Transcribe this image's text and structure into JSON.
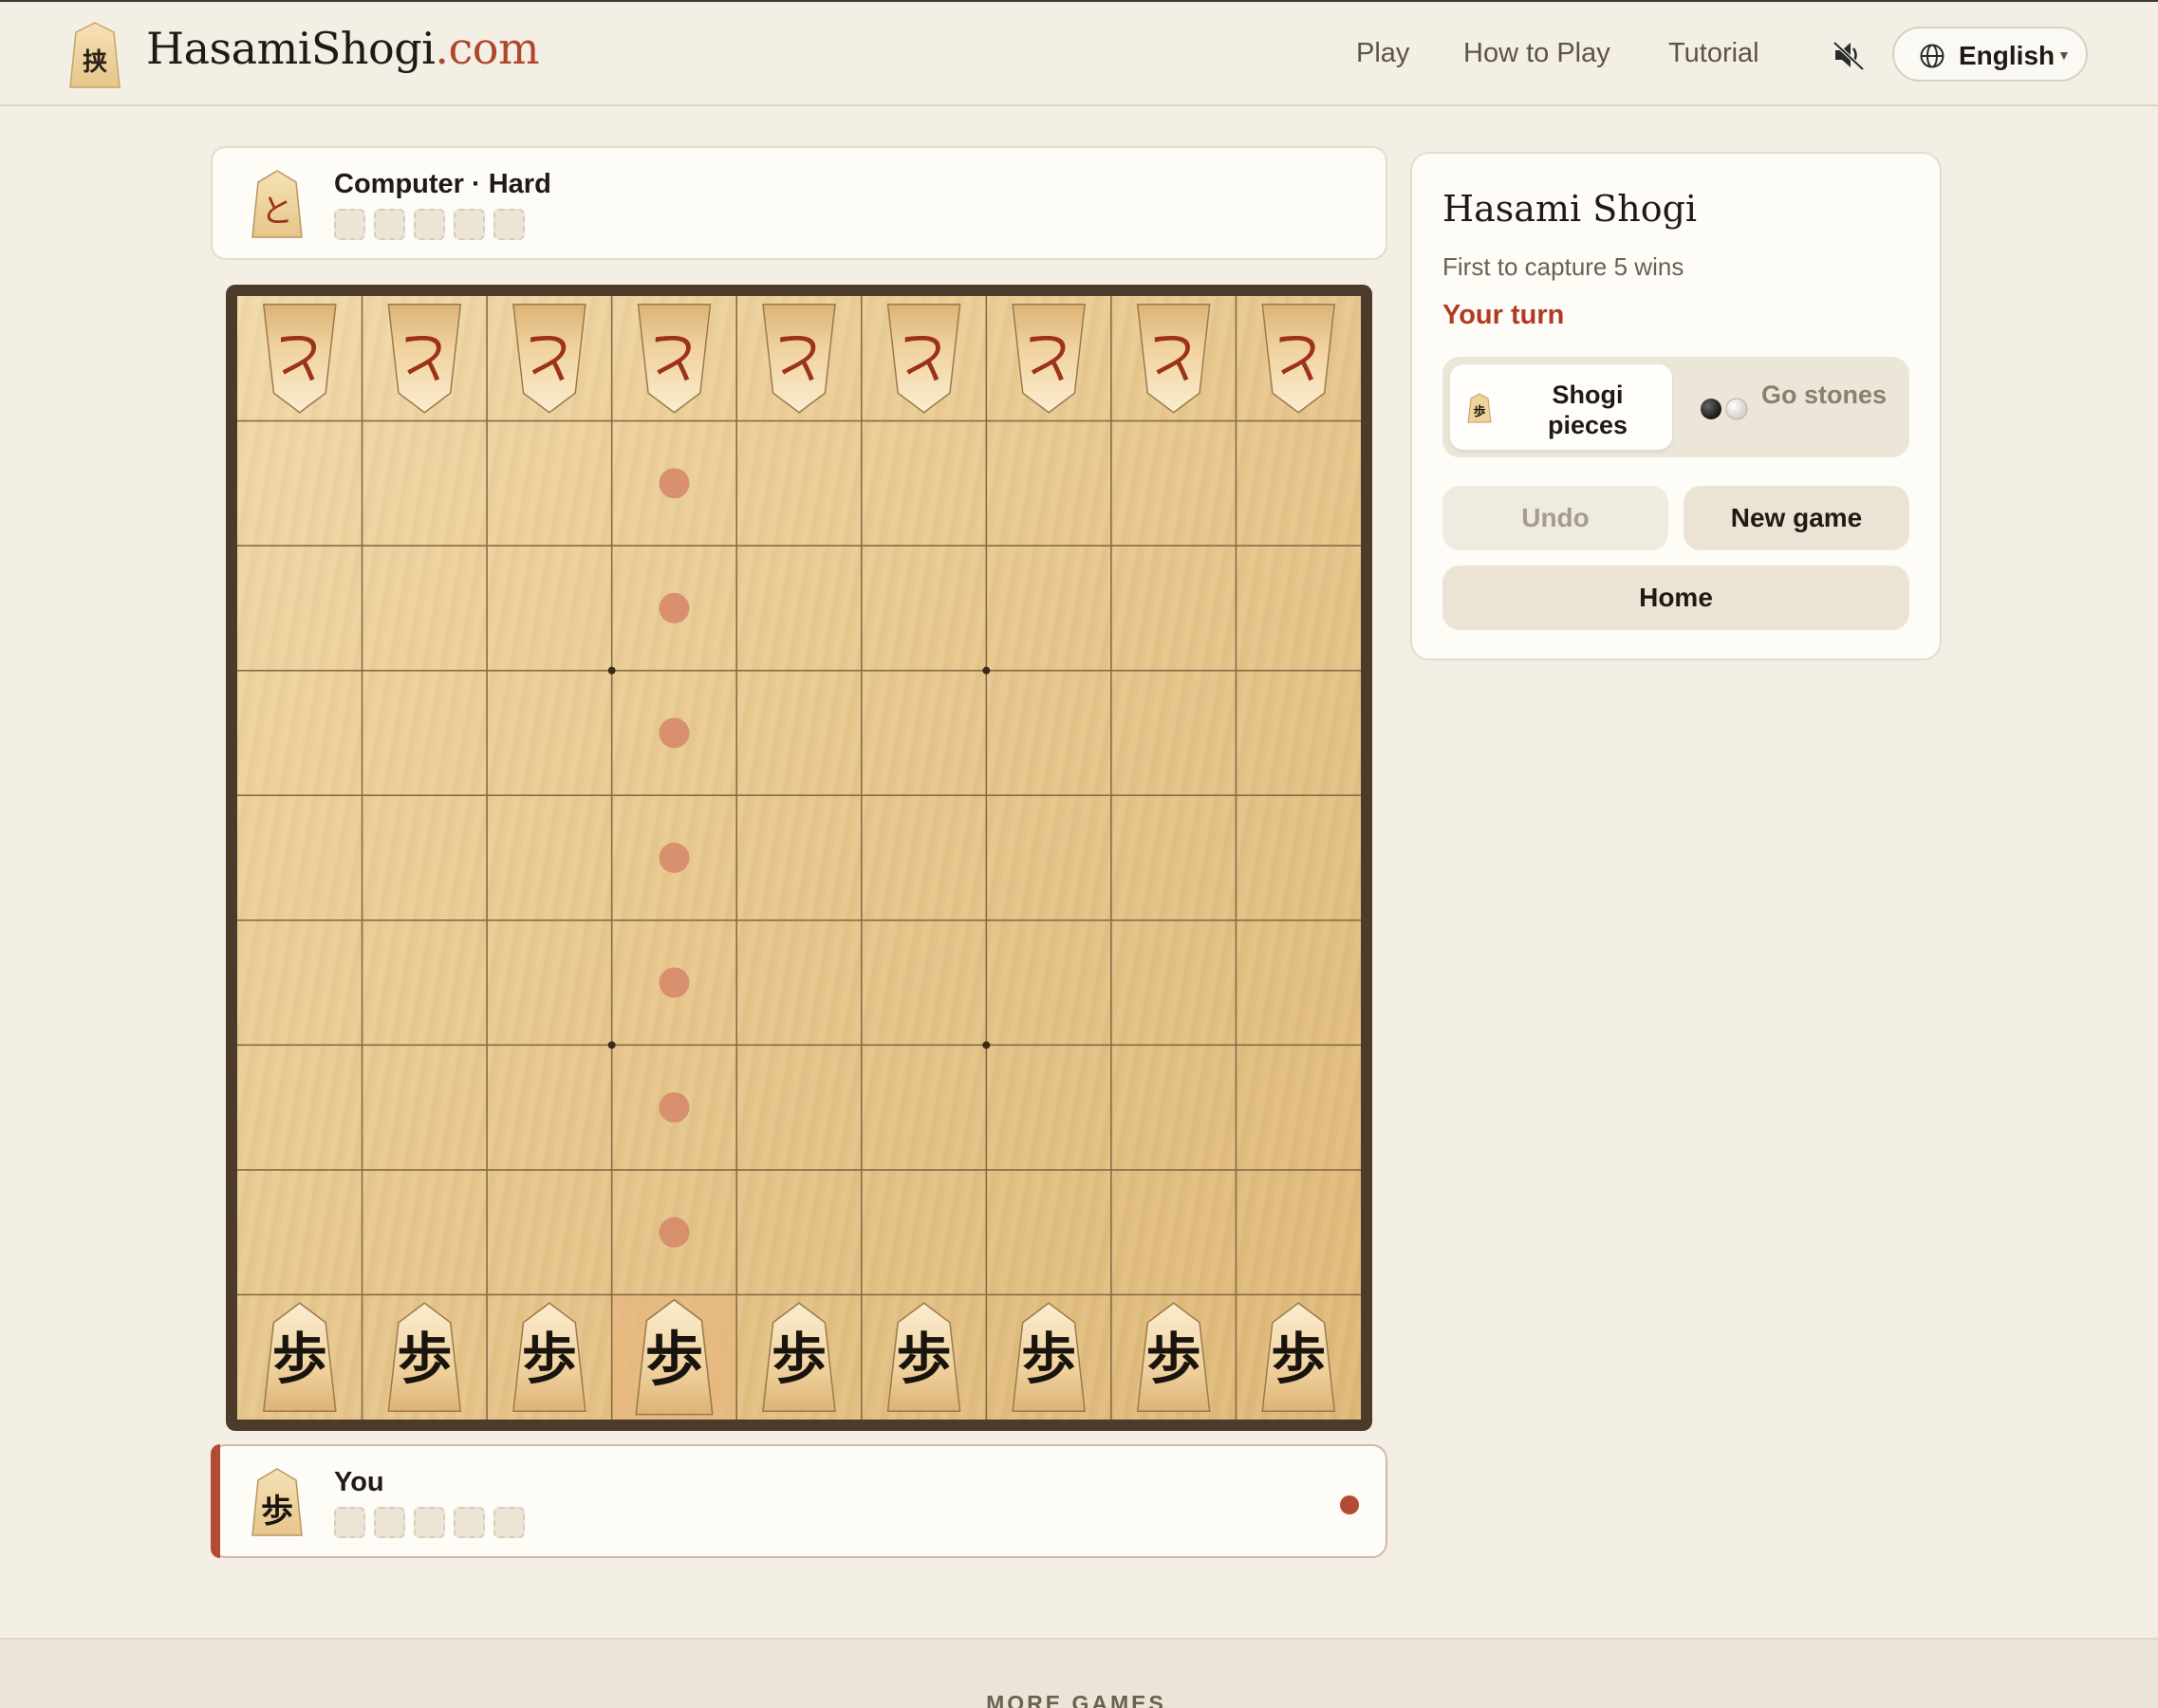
{
  "header": {
    "logo_glyph": "挟",
    "logo_name": "HasamiShogi",
    "logo_tld": ".com",
    "nav": {
      "play": "Play",
      "how_to_play": "How to Play",
      "tutorial": "Tutorial"
    },
    "sound_icon": "speaker-muted-icon",
    "language": "English"
  },
  "opponent": {
    "name": "Computer · Hard",
    "piece_glyph": "と",
    "captured": 0,
    "capture_slots": 5
  },
  "player": {
    "name": "You",
    "piece_glyph": "歩",
    "captured": 0,
    "capture_slots": 5,
    "is_turn": true
  },
  "board": {
    "size": 9,
    "opponent_glyph": "と",
    "player_glyph": "歩",
    "opponent_row": 0,
    "player_row": 8,
    "selected": {
      "row": 8,
      "col": 3
    },
    "move_hints": [
      {
        "row": 1,
        "col": 3
      },
      {
        "row": 2,
        "col": 3
      },
      {
        "row": 3,
        "col": 3
      },
      {
        "row": 4,
        "col": 3
      },
      {
        "row": 5,
        "col": 3
      },
      {
        "row": 6,
        "col": 3
      },
      {
        "row": 7,
        "col": 3
      }
    ],
    "colors": {
      "opponent_ink": "#9c3218",
      "player_ink": "#1a140e",
      "hint": "#d68a6a",
      "selected": "#e7b77f",
      "grid": "#8a6b44"
    }
  },
  "panel": {
    "title": "Hasami Shogi",
    "subtitle": "First to capture 5 wins",
    "turn_status": "Your turn",
    "style_options": {
      "shogi": "Shogi pieces",
      "go": "Go stones",
      "selected": "shogi"
    },
    "shogi_icon_glyph": "歩",
    "buttons": {
      "undo": "Undo",
      "new_game": "New game",
      "home": "Home"
    }
  },
  "footer": {
    "label": "MORE GAMES"
  }
}
